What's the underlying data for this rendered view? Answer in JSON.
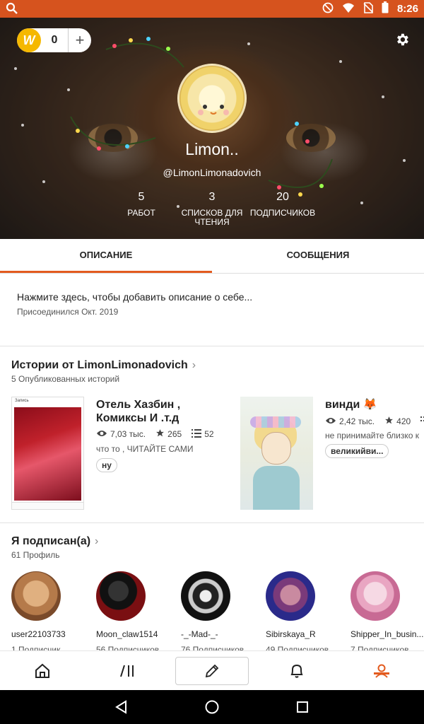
{
  "status_bar": {
    "time": "8:26"
  },
  "header": {
    "coin_count": "0",
    "coin_plus": "+",
    "coin_letter": "W",
    "name": "Limon..",
    "handle": "@LimonLimonadovich",
    "stats": [
      {
        "value": "5",
        "label": "РАБОТ"
      },
      {
        "value": "3",
        "label": "СПИСКОВ ДЛЯ ЧТЕНИЯ"
      },
      {
        "value": "20",
        "label": "ПОДПИСЧИКОВ"
      }
    ]
  },
  "tabs": [
    {
      "label": "ОПИСАНИЕ",
      "active": true
    },
    {
      "label": "СООБЩЕНИЯ",
      "active": false
    }
  ],
  "about": {
    "prompt": "Нажмите здесь, чтобы добавить описание о себе...",
    "joined": "Присоединился Окт. 2019"
  },
  "stories_section": {
    "title": "Истории от LimonLimonadovich",
    "subtitle": "5 Опубликованных историй",
    "items": [
      {
        "title_line1": "Отель Хазбин ,",
        "title_line2": "Комиксы И .т.д",
        "reads": "7,03 тыс.",
        "votes": "265",
        "parts": "52",
        "description": "что то , ЧИТАЙТЕ САМИ",
        "tag": "ну",
        "cover_top": "Запись"
      },
      {
        "title_line1": "винди 🦊",
        "reads": "2,42 тыс.",
        "votes": "420",
        "description": "не принимайте близко к",
        "tag": "великийви..."
      }
    ]
  },
  "following_section": {
    "title": "Я подписан(а)",
    "subtitle": "61 Профиль",
    "users": [
      {
        "name": "user22103733",
        "followers": "1 Подписчик"
      },
      {
        "name": "Moon_claw1514",
        "followers": "56 Подписчиков"
      },
      {
        "name": "-_-Mad-_-",
        "followers": "76 Подписчиков"
      },
      {
        "name": "Sibirskaya_R",
        "followers": "49 Подписчиков"
      },
      {
        "name": "Shipper_In_busin...",
        "followers": "7 Подписчиков"
      }
    ]
  },
  "bottom_nav": {
    "items": [
      "home-icon",
      "library-icon",
      "pencil-icon",
      "bell-icon",
      "profile-icon"
    ],
    "active": "profile-icon",
    "accent": "#e35b1f"
  },
  "colors": {
    "status_bar": "#d6531e",
    "accent": "#e35b1f",
    "coin": "#f5b800"
  }
}
